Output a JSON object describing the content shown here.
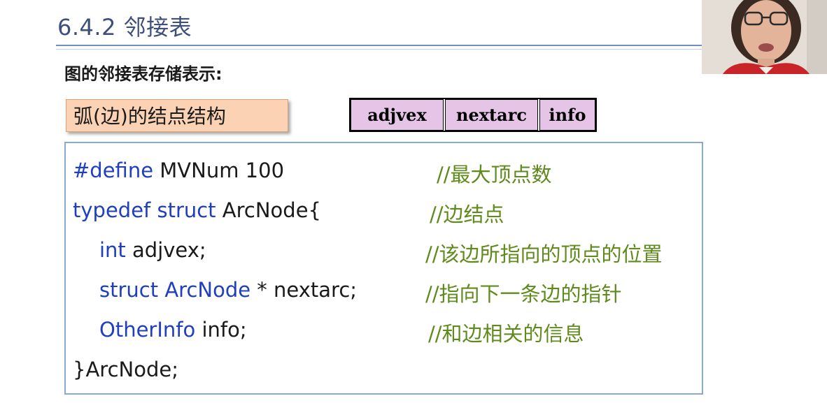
{
  "slide": {
    "title": "6.4.2 邻接表",
    "subtitle": "图的邻接表存储表示:",
    "arc_node_label": "弧(边)的结点结构"
  },
  "node_structure": {
    "fields": [
      "adjvex",
      "nextarc",
      "info"
    ],
    "field_fill_color": "#e6c4e8"
  },
  "code": {
    "lines": [
      {
        "parts": [
          {
            "kind": "kw",
            "text": "#define"
          },
          {
            "kind": "tx",
            "text": " MVNum 100"
          }
        ],
        "comment": "//最大顶点数"
      },
      {
        "parts": [
          {
            "kind": "kw",
            "text": "typedef struct"
          },
          {
            "kind": "tx",
            "text": " ArcNode{"
          }
        ],
        "comment": "//边结点"
      },
      {
        "parts": [
          {
            "kind": "kw",
            "text": "int"
          },
          {
            "kind": "tx",
            "text": " adjvex;"
          }
        ],
        "comment": "//该边所指向的顶点的位置"
      },
      {
        "parts": [
          {
            "kind": "kw",
            "text": "struct ArcNode"
          },
          {
            "kind": "tx",
            "text": " * nextarc;"
          }
        ],
        "comment": "//指向下一条边的指针"
      },
      {
        "parts": [
          {
            "kind": "kw",
            "text": "OtherInfo"
          },
          {
            "kind": "tx",
            "text": " info;"
          }
        ],
        "comment": "//和边相关的信息"
      },
      {
        "parts": [
          {
            "kind": "tx",
            "text": "}ArcNode;"
          }
        ],
        "comment": ""
      }
    ],
    "keyword_color": "#1f3fbf",
    "comment_color": "#5f8a1c"
  },
  "webcam": {
    "icon": "presenter-webcam-icon"
  }
}
